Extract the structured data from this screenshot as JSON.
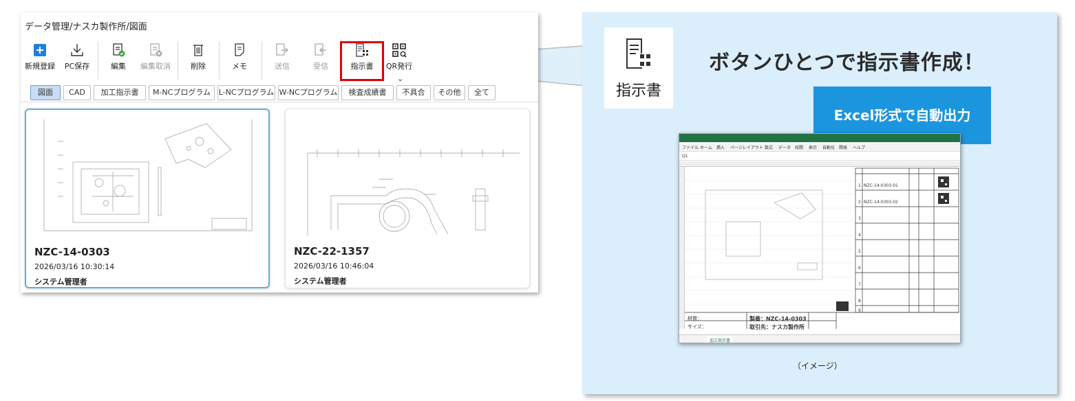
{
  "app": {
    "breadcrumb": "データ管理/ナスカ製作所/図面",
    "toolbar": [
      {
        "label": "新規登録",
        "icon": "add-icon",
        "enabled": true
      },
      {
        "label": "PC保存",
        "icon": "download-icon",
        "enabled": true
      },
      {
        "label": "編集",
        "icon": "edit-check-icon",
        "enabled": true
      },
      {
        "label": "編集取消",
        "icon": "edit-cancel-icon",
        "enabled": false
      },
      {
        "label": "削除",
        "icon": "trash-icon",
        "enabled": true
      },
      {
        "label": "メモ",
        "icon": "memo-icon",
        "enabled": true
      },
      {
        "label": "送信",
        "icon": "send-icon",
        "enabled": false
      },
      {
        "label": "受信",
        "icon": "receive-icon",
        "enabled": false
      },
      {
        "label": "指示書",
        "icon": "instruction-qr-icon",
        "enabled": true
      },
      {
        "label": "QR発行",
        "icon": "qr-code-icon",
        "enabled": true
      }
    ],
    "tabs": [
      "図面",
      "CAD",
      "加工指示書",
      "M-NCプログラム",
      "L-NCプログラム",
      "W-NCプログラム",
      "検査成績書",
      "不具合",
      "その他",
      "全て"
    ],
    "active_tab": "図面",
    "cards": [
      {
        "title": "NZC-14-0303",
        "datetime": "2026/03/16 10:30:14",
        "user": "システム管理者",
        "selected": true
      },
      {
        "title": "NZC-22-1357",
        "datetime": "2026/03/16 10:46:04",
        "user": "システム管理者",
        "selected": false
      }
    ]
  },
  "callout": {
    "icon_label": "指示書",
    "headline": "ボタンひとつで指示書作成！",
    "badge": "Excel形式で自動出力",
    "caption": "（イメージ）"
  },
  "excel": {
    "ribbon_tabs": [
      "ファイル",
      "ホーム",
      "挿入",
      "ページレイアウト",
      "数式",
      "データ",
      "校閲",
      "表示",
      "自動化",
      "開発",
      "ヘルプ"
    ],
    "cell_ref": "Q1",
    "row_numbers": [
      "1",
      "2",
      "3",
      "4",
      "5",
      "6",
      "7",
      "8",
      "9"
    ],
    "list_codes": [
      "NZC-14-0303-01",
      "NZC-14-0303-02"
    ],
    "footer_material": "材質：",
    "footer_size": "サイズ：",
    "footer_number": "製番：NZC-14-0303",
    "footer_client": "取引先：ナスカ製作所",
    "sheet_tab": "加工指示書"
  },
  "colors": {
    "accent": "#1c95df",
    "callout_bg": "#dbeefb",
    "highlight": "#e00000",
    "tab_active": "#c9dcf2",
    "add_button": "#1f80d8",
    "excel_green": "#217346"
  }
}
